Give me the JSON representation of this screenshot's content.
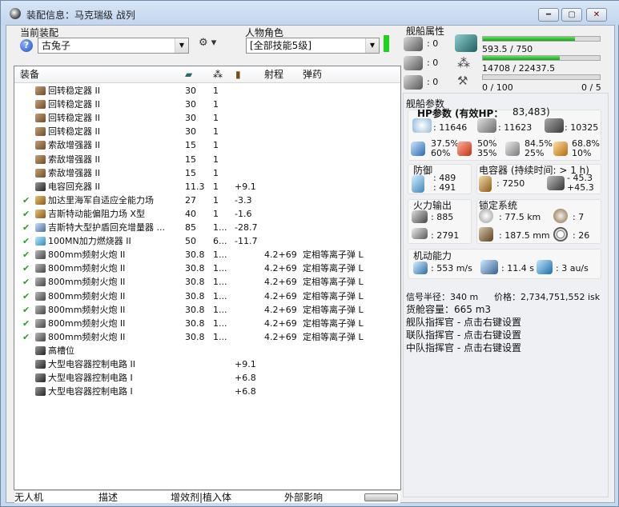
{
  "window": {
    "title": "装配信息：马克瑞级 战列"
  },
  "fit": {
    "label": "当前装配",
    "value": "古兔子"
  },
  "character": {
    "label": "人物角色",
    "value": "[全部技能5级]"
  },
  "columns": {
    "equipment": "装备",
    "range": "射程",
    "ammo": "弹药"
  },
  "modules": [
    {
      "name": "回转稳定器 II",
      "c1": "30",
      "c2": "1",
      "c3": "",
      "range": "",
      "ammo": "",
      "check": "",
      "icon": "gyro"
    },
    {
      "name": "回转稳定器 II",
      "c1": "30",
      "c2": "1",
      "c3": "",
      "range": "",
      "ammo": "",
      "check": "",
      "icon": "gyro"
    },
    {
      "name": "回转稳定器 II",
      "c1": "30",
      "c2": "1",
      "c3": "",
      "range": "",
      "ammo": "",
      "check": "",
      "icon": "gyro"
    },
    {
      "name": "回转稳定器 II",
      "c1": "30",
      "c2": "1",
      "c3": "",
      "range": "",
      "ammo": "",
      "check": "",
      "icon": "gyro"
    },
    {
      "name": "索敌增强器 II",
      "c1": "15",
      "c2": "1",
      "c3": "",
      "range": "",
      "ammo": "",
      "check": "",
      "icon": "gyro"
    },
    {
      "name": "索敌增强器 II",
      "c1": "15",
      "c2": "1",
      "c3": "",
      "range": "",
      "ammo": "",
      "check": "",
      "icon": "gyro"
    },
    {
      "name": "索敌增强器 II",
      "c1": "15",
      "c2": "1",
      "c3": "",
      "range": "",
      "ammo": "",
      "check": "",
      "icon": "gyro"
    },
    {
      "name": "电容回充器 II",
      "c1": "11.3",
      "c2": "1",
      "c3": "+9.1",
      "range": "",
      "ammo": "",
      "check": "",
      "icon": "rig"
    },
    {
      "name": "加达里海军自适应全能力场",
      "c1": "27",
      "c2": "1",
      "c3": "-3.3",
      "range": "",
      "ammo": "",
      "check": "✔",
      "icon": "hi"
    },
    {
      "name": "吉斯特动能偏阻力场 X型",
      "c1": "40",
      "c2": "1",
      "c3": "-1.6",
      "range": "",
      "ammo": "",
      "check": "✔",
      "icon": "hi"
    },
    {
      "name": "吉斯特大型护盾回充增量器 ...",
      "c1": "85",
      "c2": "1...",
      "c3": "-28.7",
      "range": "",
      "ammo": "",
      "check": "✔",
      "icon": "shd"
    },
    {
      "name": "100MN加力燃烧器 II",
      "c1": "50",
      "c2": "6...",
      "c3": "-11.7",
      "range": "",
      "ammo": "",
      "check": "✔",
      "icon": "ab"
    },
    {
      "name": "800mm频射火炮 II",
      "c1": "30.8",
      "c2": "1...",
      "c3": "",
      "range": "4.2+69",
      "ammo": "定相等离子弹 L",
      "check": "✔",
      "icon": "gun"
    },
    {
      "name": "800mm频射火炮 II",
      "c1": "30.8",
      "c2": "1...",
      "c3": "",
      "range": "4.2+69",
      "ammo": "定相等离子弹 L",
      "check": "✔",
      "icon": "gun"
    },
    {
      "name": "800mm频射火炮 II",
      "c1": "30.8",
      "c2": "1...",
      "c3": "",
      "range": "4.2+69",
      "ammo": "定相等离子弹 L",
      "check": "✔",
      "icon": "gun"
    },
    {
      "name": "800mm频射火炮 II",
      "c1": "30.8",
      "c2": "1...",
      "c3": "",
      "range": "4.2+69",
      "ammo": "定相等离子弹 L",
      "check": "✔",
      "icon": "gun"
    },
    {
      "name": "800mm频射火炮 II",
      "c1": "30.8",
      "c2": "1...",
      "c3": "",
      "range": "4.2+69",
      "ammo": "定相等离子弹 L",
      "check": "✔",
      "icon": "gun"
    },
    {
      "name": "800mm频射火炮 II",
      "c1": "30.8",
      "c2": "1...",
      "c3": "",
      "range": "4.2+69",
      "ammo": "定相等离子弹 L",
      "check": "✔",
      "icon": "gun"
    },
    {
      "name": "800mm频射火炮 II",
      "c1": "30.8",
      "c2": "1...",
      "c3": "",
      "range": "4.2+69",
      "ammo": "定相等离子弹 L",
      "check": "✔",
      "icon": "gun"
    },
    {
      "name": "高槽位",
      "c1": "",
      "c2": "",
      "c3": "",
      "range": "",
      "ammo": "",
      "check": "",
      "icon": "slot"
    },
    {
      "name": "大型电容器控制电路 II",
      "c1": "",
      "c2": "",
      "c3": "+9.1",
      "range": "",
      "ammo": "",
      "check": "",
      "icon": "rig"
    },
    {
      "name": "大型电容器控制电路 I",
      "c1": "",
      "c2": "",
      "c3": "+6.8",
      "range": "",
      "ammo": "",
      "check": "",
      "icon": "rig"
    },
    {
      "name": "大型电容器控制电路 I",
      "c1": "",
      "c2": "",
      "c3": "+6.8",
      "range": "",
      "ammo": "",
      "check": "",
      "icon": "rig"
    }
  ],
  "ship": {
    "title": "舰船属性",
    "slot_vals": [
      ": 0",
      ": 0",
      ": 0"
    ],
    "cpu": "593.5 / 750",
    "cpu_fraction": 0.79,
    "pg": "14708 / 22437.5",
    "pg_fraction": 0.66,
    "calib": "0 / 100",
    "calib_fraction": 0,
    "rigs": "0 / 5"
  },
  "params": {
    "title": "舰船参数",
    "hp_label": "HP参数 (有效HP：",
    "hp_value": "83,483)",
    "shield_hp": ": 11646",
    "armor_hp": ": 11623",
    "hull_hp": ": 10325",
    "res": [
      [
        "37.5%",
        "60%"
      ],
      [
        "50%",
        "35%"
      ],
      [
        "84.5%",
        "25%"
      ],
      [
        "68.8%",
        "10%"
      ]
    ]
  },
  "defense": {
    "title": "防御",
    "v1": ": 489",
    "v2": ": 491"
  },
  "cap": {
    "title": "电容器 (持续时间: > 1 h)",
    "v1": ": 7250",
    "v2": "- 45.3",
    "v3": "+45.3"
  },
  "fire": {
    "title": "火力输出",
    "dps": ": 885",
    "volley": ": 2791"
  },
  "lock": {
    "title": "锁定系统",
    "range": ": 77.5 km",
    "targets": ": 7",
    "scan": ": 187.5 mm",
    "sensor": ": 26"
  },
  "mobility": {
    "title": "机动能力",
    "speed": ": 553 m/s",
    "align": ": 11.4 s",
    "warp": ": 3 au/s"
  },
  "misc": {
    "sig": "信号半径：340 m",
    "price": "价格：2,734,751,552 isk",
    "cargo": "货舱容量：665 m3",
    "fleet": "舰队指挥官 - 点击右键设置",
    "wing": "联队指挥官 - 点击右键设置",
    "squad": "中队指挥官 - 点击右键设置"
  },
  "tabs": [
    "无人机",
    "描述",
    "增效剂|植入体",
    "外部影响"
  ]
}
